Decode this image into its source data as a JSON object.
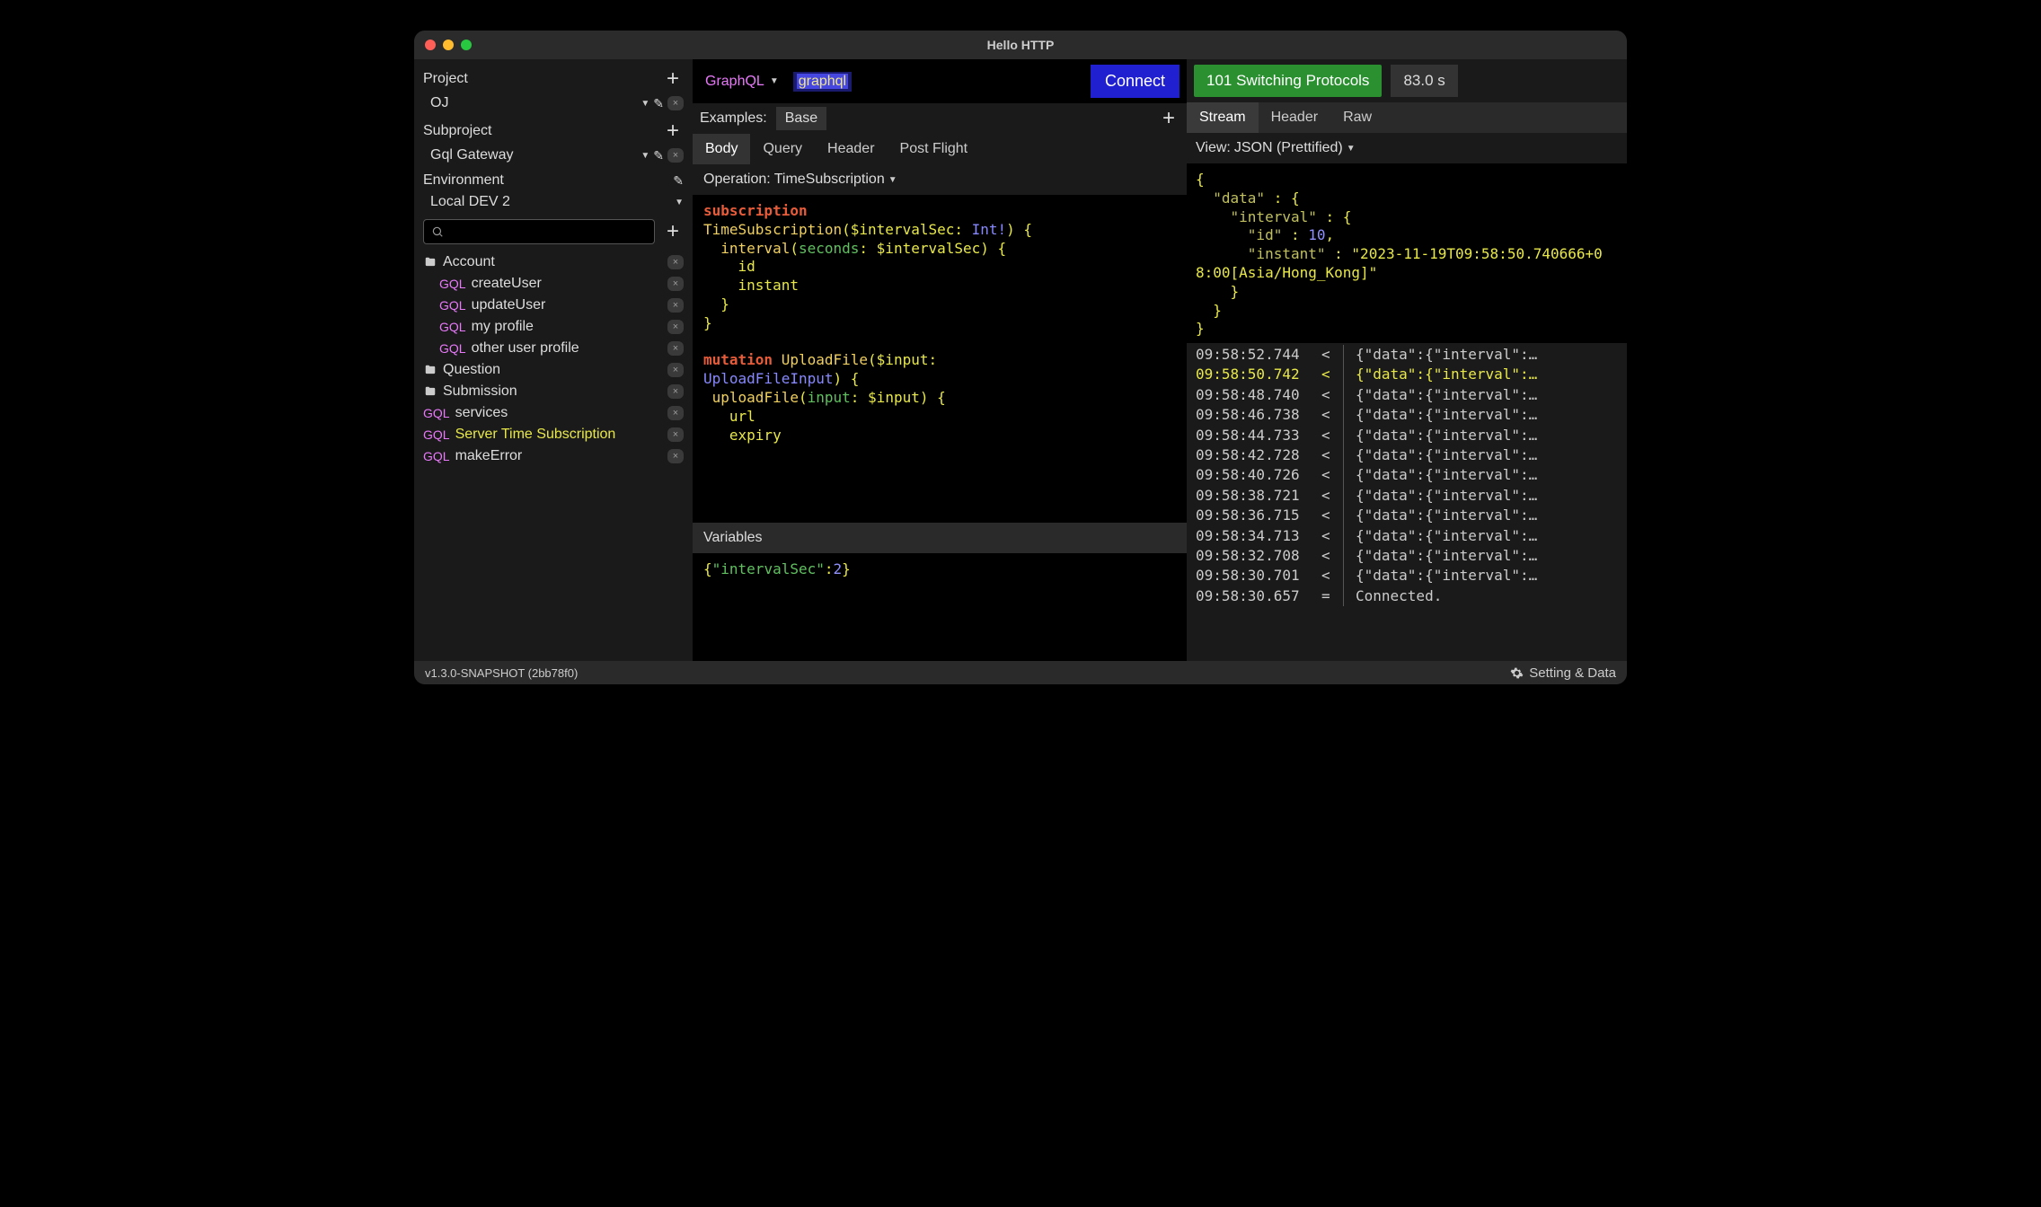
{
  "window_title": "Hello HTTP",
  "sidebar": {
    "project_label": "Project",
    "project_value": "OJ",
    "subproject_label": "Subproject",
    "subproject_value": "Gql Gateway",
    "environment_label": "Environment",
    "environment_value": "Local DEV 2",
    "folders": [
      {
        "name": "Account",
        "items": [
          {
            "tag": "GQL",
            "label": "createUser"
          },
          {
            "tag": "GQL",
            "label": "updateUser"
          },
          {
            "tag": "GQL",
            "label": "my profile"
          },
          {
            "tag": "GQL",
            "label": "other user profile"
          }
        ]
      },
      {
        "name": "Question",
        "items": []
      },
      {
        "name": "Submission",
        "items": []
      }
    ],
    "root_items": [
      {
        "tag": "GQL",
        "label": "services"
      },
      {
        "tag": "GQL",
        "label": "Server Time Subscription",
        "active": true
      },
      {
        "tag": "GQL",
        "label": "makeError"
      }
    ]
  },
  "center": {
    "protocol": "GraphQL",
    "url": "graphql",
    "connect_label": "Connect",
    "examples_label": "Examples:",
    "example_chip": "Base",
    "tabs": [
      "Body",
      "Query",
      "Header",
      "Post Flight"
    ],
    "active_tab": "Body",
    "operation_label": "Operation:",
    "operation_value": "TimeSubscription",
    "editor_lines": [
      {
        "t": "kw-sub",
        "v": "subscription"
      },
      {
        "raw": "TimeSubscription($intervalSec: Int!) {"
      },
      {
        "raw": "  interval(seconds: $intervalSec) {"
      },
      {
        "raw": "    id"
      },
      {
        "raw": "    instant"
      },
      {
        "raw": "  }"
      },
      {
        "raw": "}"
      },
      {
        "raw": ""
      },
      {
        "raw": "mutation UploadFile($input:"
      },
      {
        "raw": "UploadFileInput) {"
      },
      {
        "raw": " uploadFile(input: $input) {"
      },
      {
        "raw": "   url"
      },
      {
        "raw": "   expiry"
      }
    ],
    "variables_label": "Variables",
    "variables_body": "{\"intervalSec\":2}"
  },
  "right": {
    "status": "101 Switching Protocols",
    "time": "83.0 s",
    "tabs": [
      "Stream",
      "Header",
      "Raw"
    ],
    "active_tab": "Stream",
    "view_label": "View:",
    "view_value": "JSON (Prettified)",
    "json_body": "{\n  \"data\" : {\n    \"interval\" : {\n      \"id\" : 10,\n      \"instant\" : \"2023-11-19T09:58:50.740666+08:00[Asia/Hong_Kong]\"\n    }\n  }\n}",
    "log": [
      {
        "time": "09:58:52.744",
        "dir": "<",
        "body": "{\"data\":{\"interval\":…"
      },
      {
        "time": "09:58:50.742",
        "dir": "<",
        "body": "{\"data\":{\"interval\":…",
        "hl": true
      },
      {
        "time": "09:58:48.740",
        "dir": "<",
        "body": "{\"data\":{\"interval\":…"
      },
      {
        "time": "09:58:46.738",
        "dir": "<",
        "body": "{\"data\":{\"interval\":…"
      },
      {
        "time": "09:58:44.733",
        "dir": "<",
        "body": "{\"data\":{\"interval\":…"
      },
      {
        "time": "09:58:42.728",
        "dir": "<",
        "body": "{\"data\":{\"interval\":…"
      },
      {
        "time": "09:58:40.726",
        "dir": "<",
        "body": "{\"data\":{\"interval\":…"
      },
      {
        "time": "09:58:38.721",
        "dir": "<",
        "body": "{\"data\":{\"interval\":…"
      },
      {
        "time": "09:58:36.715",
        "dir": "<",
        "body": "{\"data\":{\"interval\":…"
      },
      {
        "time": "09:58:34.713",
        "dir": "<",
        "body": "{\"data\":{\"interval\":…"
      },
      {
        "time": "09:58:32.708",
        "dir": "<",
        "body": "{\"data\":{\"interval\":…"
      },
      {
        "time": "09:58:30.701",
        "dir": "<",
        "body": "{\"data\":{\"interval\":…"
      },
      {
        "time": "09:58:30.657",
        "dir": "=",
        "body": "Connected."
      }
    ]
  },
  "statusbar": {
    "version": "v1.3.0-SNAPSHOT (2bb78f0)",
    "settings": "Setting & Data"
  }
}
